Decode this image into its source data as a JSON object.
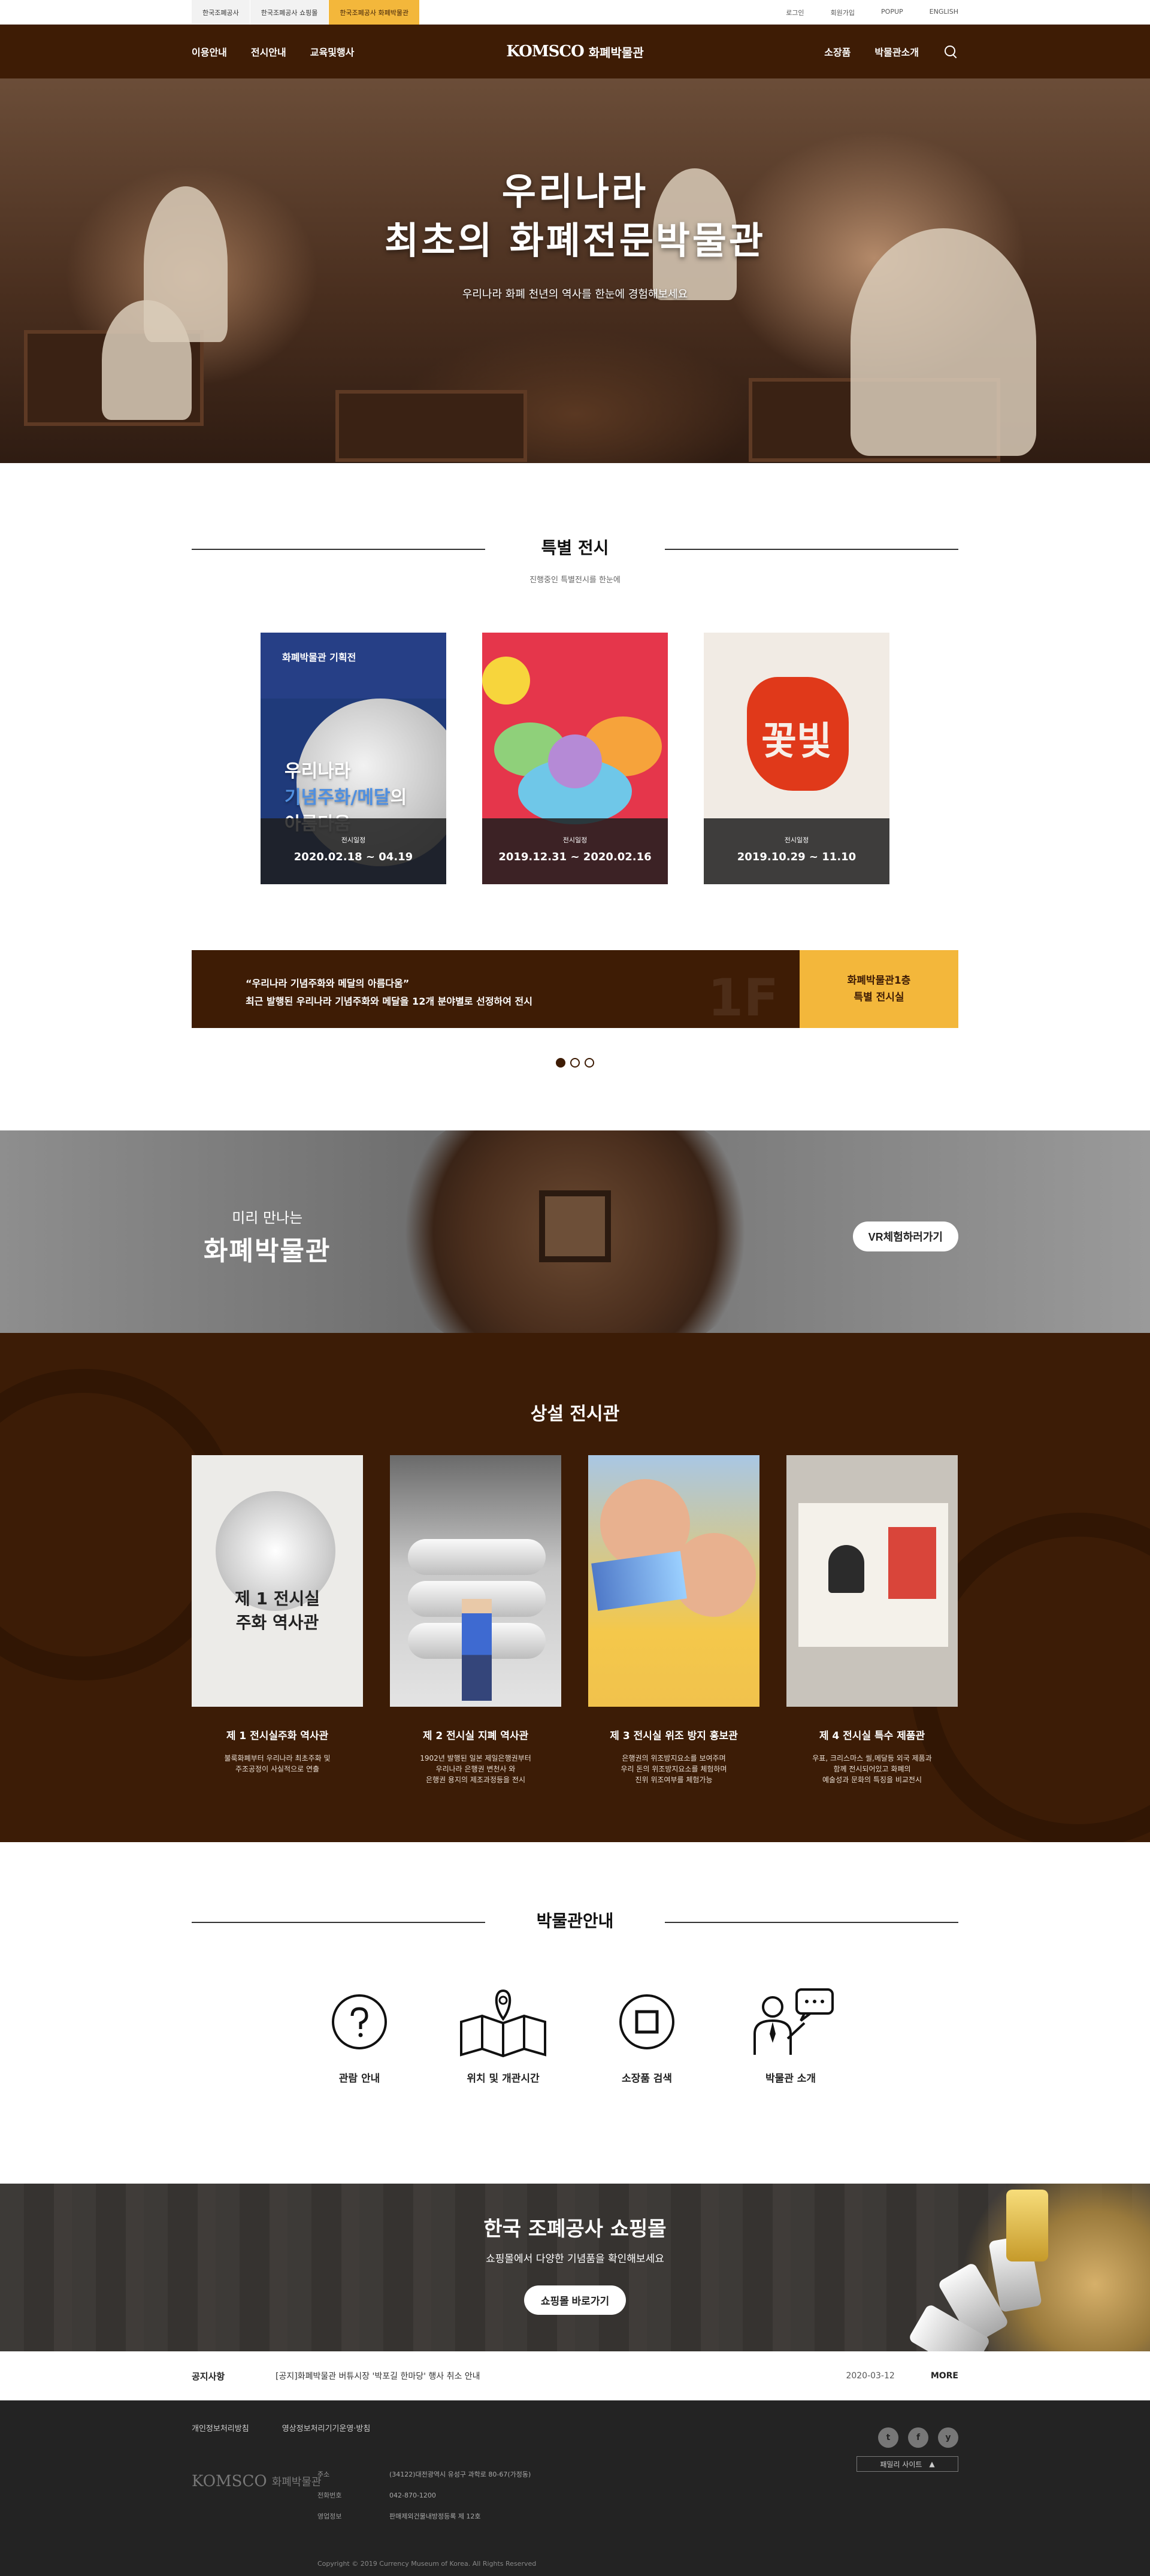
{
  "util": {
    "site_tabs": [
      "한국조폐공사",
      "한국조폐공사 쇼핑몰",
      "한국조폐공사 화폐박물관"
    ],
    "links": [
      "로그인",
      "회원가입",
      "POPUP",
      "ENGLISH"
    ]
  },
  "gnb": {
    "left": [
      "이용안내",
      "전시안내",
      "교육및행사"
    ],
    "logo_mark": "KOMSCO",
    "logo_text": "화폐박물관",
    "right": [
      "소장품",
      "박물관소개"
    ]
  },
  "hero": {
    "title_line1": "우리나라",
    "title_line2": "최초의 화폐전문박물관",
    "subtitle": "우리나라 화폐 천년의 역사를 한눈에 경험해보세요"
  },
  "special": {
    "title": "특별 전시",
    "subtitle": "진행중인 특별전시를 한눈에",
    "cards": [
      {
        "top": "화폐박물관 기획전",
        "big1": "우리나라",
        "big2a": "기념주화/메달",
        "big2b": "의",
        "big3": "아름다움",
        "label": "전시일정",
        "date": "2020.02.18 ~ 04.19"
      },
      {
        "label": "전시일정",
        "date": "2019.12.31 ~ 2020.02.16"
      },
      {
        "art": "꽃빛",
        "label": "전시일정",
        "date": "2019.10.29 ~ 11.10"
      }
    ],
    "banner": {
      "line1": "“우리나라 기념주화와 메달의 아름다움”",
      "line2": "최근 발행된 우리나라 기념주화와 메달을 12개 분야별로 선정하여 전시",
      "floor": "1F",
      "side1": "화폐박물관1층",
      "side2": "특별 전시실"
    }
  },
  "vr": {
    "line1": "미리 만나는",
    "line2": "화폐박물관",
    "button": "VR체험하러가기"
  },
  "permanent": {
    "title": "상설 전시관",
    "cards": [
      {
        "img1": "제 1 전시실",
        "img2": "주화 역사관",
        "title": "제 1 전시실주화 역사관",
        "desc": [
          "불룩화폐부터 우리나라 최초주화 및",
          "주조공정이 사실적으로 연출"
        ]
      },
      {
        "title": "제 2 전시실 지폐 역사관",
        "desc": [
          "1902년 발행된 일본 제일은행권부터",
          "우리나라 은행권 변천사 와",
          "은행권 용지의 제조과정등을 전시"
        ]
      },
      {
        "title": "제 3 전시실 위조 방지 홍보관",
        "desc": [
          "은행권의 위조방지요소를 보여주며",
          "우리 돈의 위조방지요소를 체험하며",
          "진위 위조여부를 체험가능"
        ]
      },
      {
        "title": "제 4 전시실 특수 제품관",
        "desc": [
          "우표, 크리스마스 씰,메달등 외국 제품과",
          "함께 전시되어있고 화폐의",
          "예술성과 문화의 특징을 비교전시"
        ]
      }
    ]
  },
  "guide": {
    "title": "박물관안내",
    "items": [
      "관람 안내",
      "위치 및 개관시간",
      "소장품 검색",
      "박물관 소개"
    ]
  },
  "shop": {
    "title": "한국 조폐공사 쇼핑몰",
    "subtitle": "쇼핑몰에서 다양한 기념품을 확인해보세요",
    "button": "쇼핑몰 바로가기"
  },
  "notice": {
    "label": "공지사항",
    "text": "[공지]화폐박물관 버튜시장 '박포길 한마당' 행사 취소 안내",
    "date": "2020-03-12",
    "more": "MORE"
  },
  "footer": {
    "links": [
      "개인정보처리방침",
      "영상정보처리기기운영·방침"
    ],
    "logo_mark": "KOMSCO",
    "logo_text": "화폐박물관",
    "rows": [
      {
        "k": "주소",
        "v": "(34122)대전광역시 유성구 과학로 80-67(가정동)"
      },
      {
        "k": "전화번호",
        "v": "042-870-1200"
      },
      {
        "k": "영업정보",
        "v": "판매제외건물내방정등록 제 12호"
      }
    ],
    "copyright": "Copyright © 2019 Currency Museum of Korea. All Rights Reserved",
    "social": [
      "t",
      "f",
      "y"
    ],
    "family_site": "패밀리 사이트"
  }
}
